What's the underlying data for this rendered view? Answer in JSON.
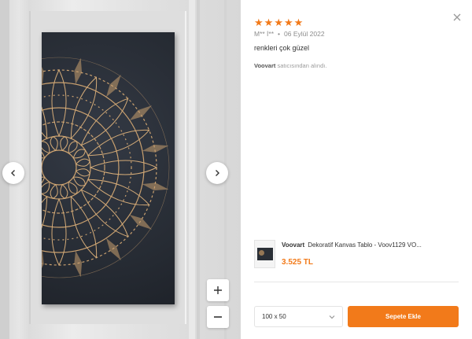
{
  "review": {
    "rating": 5,
    "stars": [
      "★",
      "★",
      "★",
      "★",
      "★"
    ],
    "author": "M** İ**",
    "dot": "•",
    "date": "06 Eylül 2022",
    "comment": "renkleri çok güzel",
    "seller_name": "Voovart",
    "seller_suffix": " satıcısından alındı."
  },
  "product": {
    "brand": "Voovart",
    "title": "Dekoratif Kanvas Tablo - Voov1129 VO...",
    "price": "3.525 TL"
  },
  "purchase": {
    "size_value": "100 x 50",
    "add_to_cart_label": "Sepete Ekle"
  },
  "colors": {
    "accent": "#f27a1a",
    "canvas": "#262b33",
    "gold": "#c9a06f"
  },
  "icons": {
    "prev": "chevron-left-icon",
    "next": "chevron-right-icon",
    "zoom_in": "plus-icon",
    "zoom_out": "minus-icon",
    "close": "close-icon",
    "dropdown": "chevron-down-icon"
  }
}
